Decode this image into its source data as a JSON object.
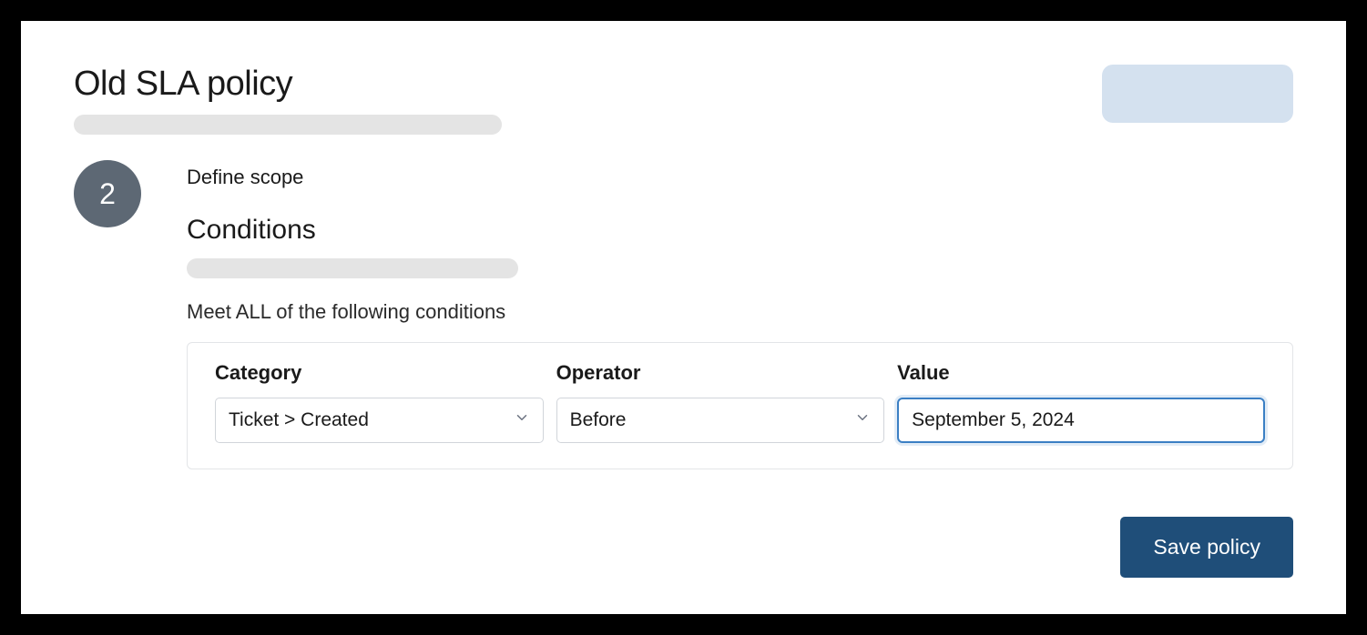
{
  "page": {
    "title": "Old SLA policy"
  },
  "step": {
    "number": "2",
    "heading": "Define scope"
  },
  "conditions": {
    "title": "Conditions",
    "instruction": "Meet ALL of the following conditions",
    "columns": {
      "category": {
        "label": "Category",
        "value": "Ticket > Created"
      },
      "operator": {
        "label": "Operator",
        "value": "Before"
      },
      "value": {
        "label": "Value",
        "value": "September 5, 2024"
      }
    }
  },
  "actions": {
    "save": "Save policy"
  }
}
